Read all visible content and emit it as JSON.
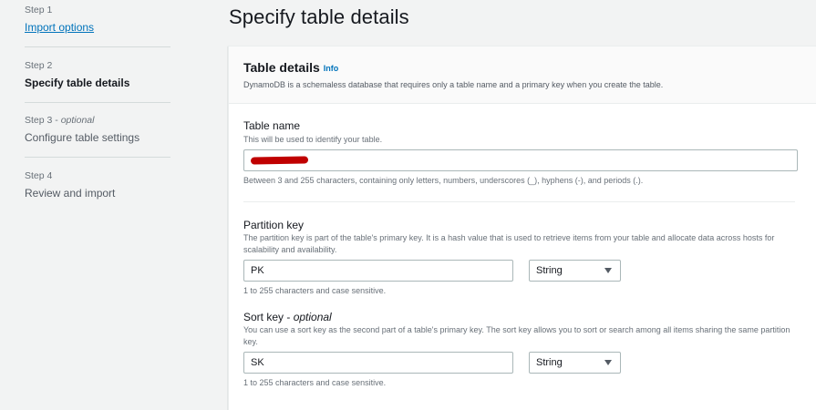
{
  "steps": [
    {
      "number": "Step 1",
      "title": "Import options"
    },
    {
      "number": "Step 2",
      "title": "Specify table details"
    },
    {
      "number": "Step 3",
      "optional": "optional",
      "title": "Configure table settings"
    },
    {
      "number": "Step 4",
      "title": "Review and import"
    }
  ],
  "page_title": "Specify table details",
  "card": {
    "title": "Table details",
    "info_label": "Info",
    "description": "DynamoDB is a schemaless database that requires only a table name and a primary key when you create the table."
  },
  "table_name": {
    "label": "Table name",
    "description": "This will be used to identify your table.",
    "value": "",
    "constraint": "Between 3 and 255 characters, containing only letters, numbers, underscores (_), hyphens (-), and periods (.)."
  },
  "partition_key": {
    "label": "Partition key",
    "description": "The partition key is part of the table's primary key. It is a hash value that is used to retrieve items from your table and allocate data across hosts for scalability and availability.",
    "value": "PK",
    "type": "String",
    "constraint": "1 to 255 characters and case sensitive."
  },
  "sort_key": {
    "label": "Sort key",
    "optional_label": "optional",
    "description": "You can use a sort key as the second part of a table's primary key. The sort key allows you to sort or search among all items sharing the same partition key.",
    "value": "SK",
    "type": "String",
    "constraint": "1 to 255 characters and case sensitive."
  },
  "colors": {
    "accent": "#0073bb",
    "redaction": "#c00000"
  }
}
